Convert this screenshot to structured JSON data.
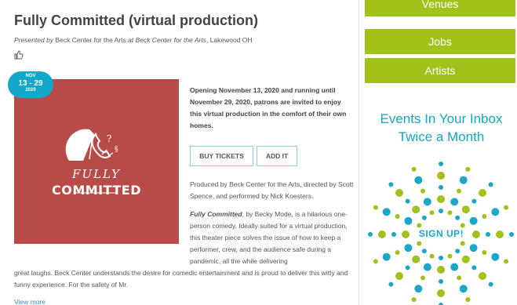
{
  "event": {
    "title": "Fully Committed (virtual production)",
    "presented_prefix": "Presented by",
    "presenter": "Beck Center for the Arts",
    "at_prefix": "at",
    "venue": "Beck Center for the Arts",
    "location": ", Lakewood OH",
    "like_icon": "thumbs-up-icon"
  },
  "date_badge": {
    "month": "NOV",
    "days": "13 - 29",
    "year": "2020"
  },
  "poster": {
    "logo_line1": "FULLY",
    "logo_line2": "COMMITTED",
    "background": "#b84b47"
  },
  "opening_text": "Opening November 13, 2020 and running until November 29, 2020, patrons are invited to enjoy this virtual production in the comfort of their own homes.",
  "buttons": {
    "buy_tickets": "BUY TICKETS",
    "add_it": "ADD IT"
  },
  "produced_text": "Produced by Beck Center for the Arts, directed by Scott Spence, and performed by Nick Koesters.",
  "description": {
    "title_italic": "Fully Committed",
    "part1": ", by Becky Mode, is a hilarious one-person comedy. Ideally suited for a virtual production, this theater piece solves the issue of how to keep a performer, crew, and the audience safe during a pandemic, all the while delivering",
    "part2": "great laughs. Beck Center understands the desire for comedic entertainment and is proud to deliver this witty and funny experience. For the safety of Mr."
  },
  "view_more": "View more",
  "sidebar": {
    "venues": "Venues",
    "jobs": "Jobs",
    "artists": "Artists",
    "accent": "#a1c21a"
  },
  "promo": {
    "title_line1": "Events In Your Inbox",
    "title_line2": "Twice a Month",
    "signup": "SIGN UP!",
    "teal": "#1aa7c8",
    "green": "#a1c21a"
  }
}
